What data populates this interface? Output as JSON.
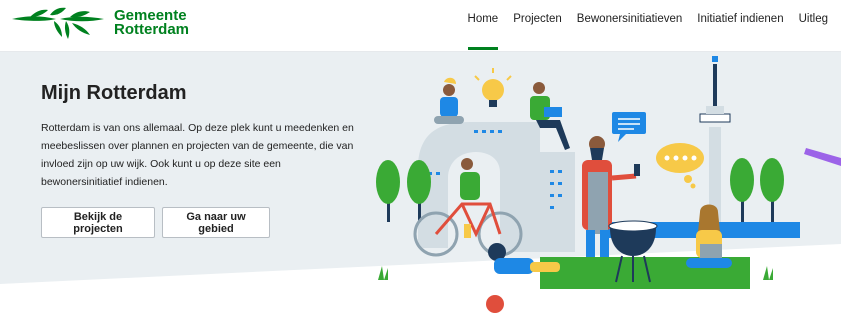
{
  "brand": {
    "name_line1": "Gemeente",
    "name_line2": "Rotterdam",
    "color": "#00811f"
  },
  "nav": {
    "items": [
      {
        "label": "Home",
        "active": true
      },
      {
        "label": "Projecten",
        "active": false
      },
      {
        "label": "Bewonersinitiatieven",
        "active": false
      },
      {
        "label": "Initiatief indienen",
        "active": false
      },
      {
        "label": "Uitleg",
        "active": false
      }
    ]
  },
  "hero": {
    "title": "Mijn Rotterdam",
    "intro": "Rotterdam is van ons allemaal. Op deze plek kunt u meedenken en meebeslissen over plannen en projecten van de gemeente, die van invloed zijn op uw wijk. Ook kunt u op deze site een bewonersinitiatief indienen.",
    "buttons": {
      "projects": "Bekijk de projecten",
      "area": "Ga naar uw gebied"
    },
    "background": "#eaeff2",
    "illustration_icons": [
      "lightbulb-icon",
      "chat-bubble-icon",
      "thought-bubble-icon",
      "euromast-tower",
      "bicycle",
      "barbecue",
      "trees",
      "laptop"
    ]
  },
  "colors": {
    "accent_green": "#00811f",
    "illustration_green": "#3aaa35",
    "illustration_blue": "#1e88e5",
    "purple_accent": "#9c63e8"
  }
}
